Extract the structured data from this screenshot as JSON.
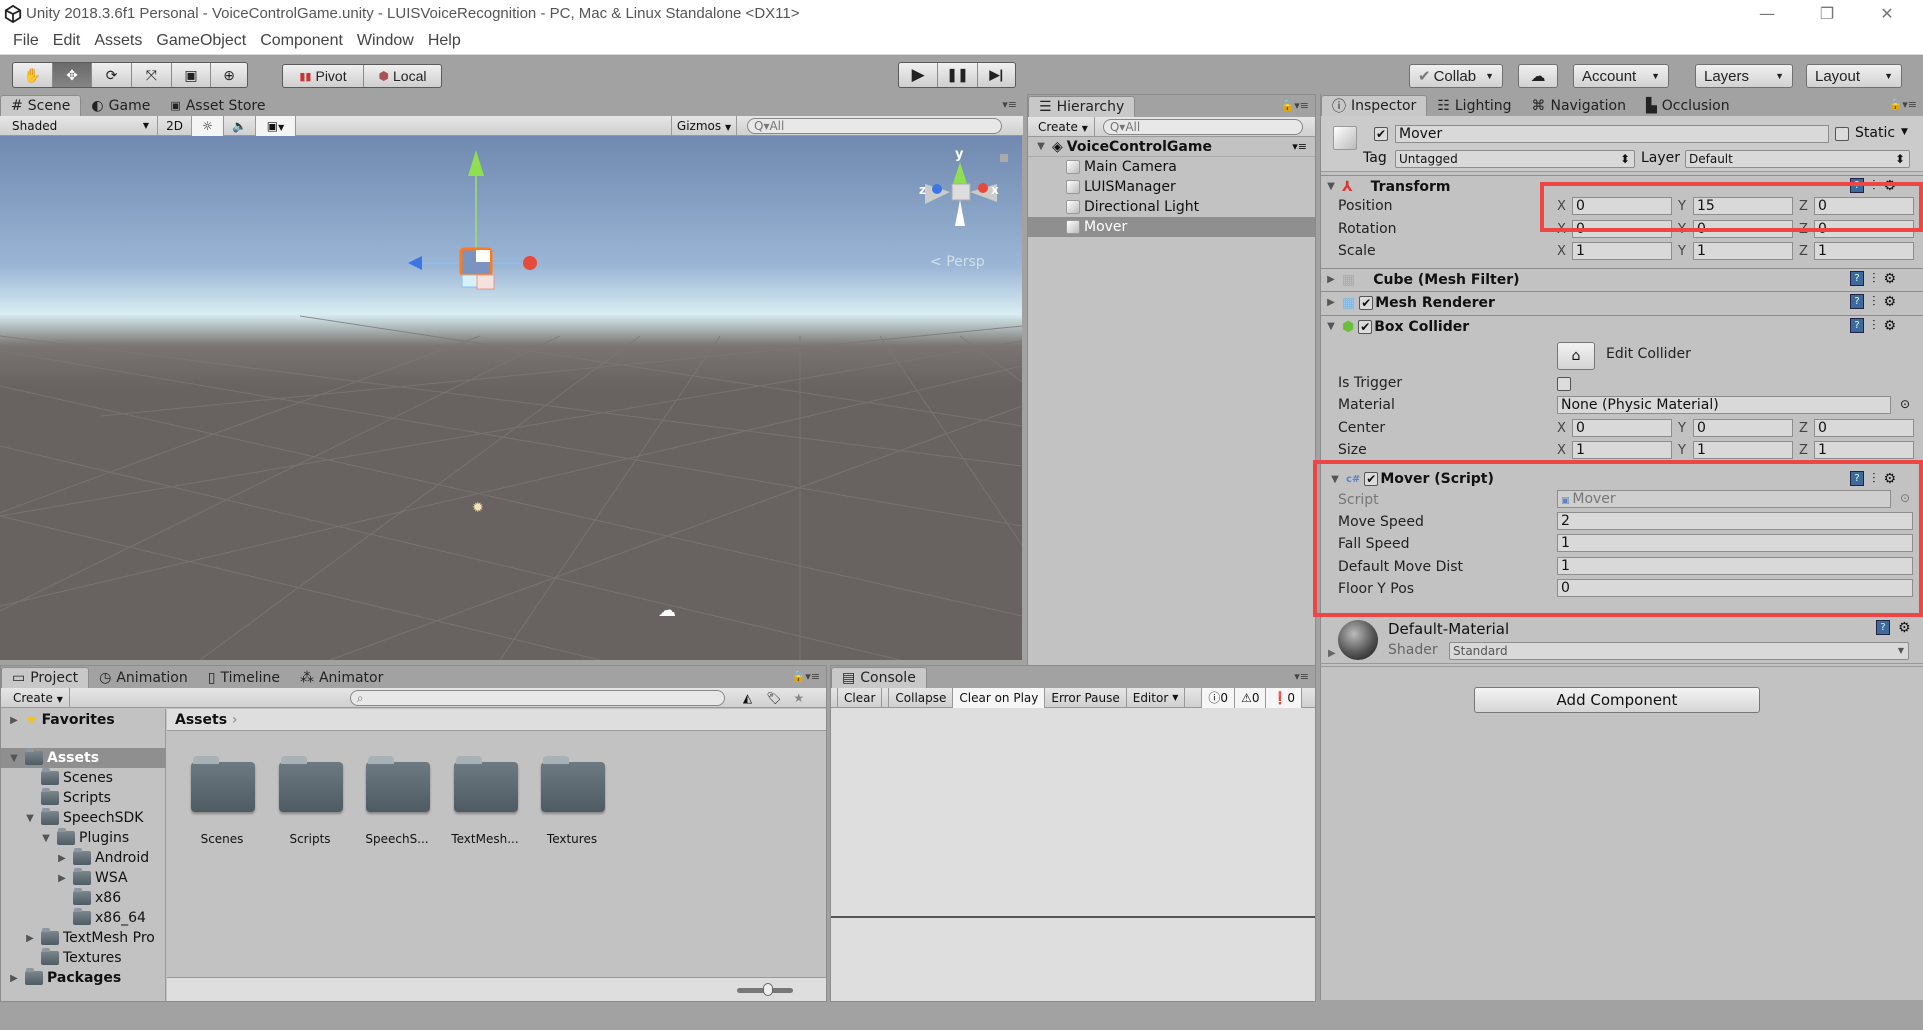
{
  "window": {
    "title": "Unity 2018.3.6f1 Personal - VoiceControlGame.unity - LUISVoiceRecognition - PC, Mac & Linux Standalone <DX11>",
    "controls": {
      "minimize": "—",
      "maximize": "❐",
      "close": "✕"
    }
  },
  "menu": [
    "File",
    "Edit",
    "Assets",
    "GameObject",
    "Component",
    "Window",
    "Help"
  ],
  "toolbar": {
    "tools": [
      {
        "name": "hand-tool",
        "glyph": "✋",
        "active": false
      },
      {
        "name": "move-tool",
        "glyph": "✥",
        "active": true
      },
      {
        "name": "rotate-tool",
        "glyph": "⟳",
        "active": false
      },
      {
        "name": "scale-tool",
        "glyph": "⤧",
        "active": false
      },
      {
        "name": "rect-tool",
        "glyph": "▣",
        "active": false
      },
      {
        "name": "transform-tool",
        "glyph": "⊕",
        "active": false
      }
    ],
    "pivot_label": "Pivot",
    "local_label": "Local",
    "play": "▶",
    "pause": "❚❚",
    "step": "▶|",
    "collab_label": "Collab",
    "cloud_glyph": "☁",
    "account_label": "Account",
    "layers_label": "Layers",
    "layout_label": "Layout"
  },
  "scene_panel": {
    "tabs": [
      {
        "label": "Scene",
        "icon": "#",
        "active": true
      },
      {
        "label": "Game",
        "icon": "◐",
        "active": false
      },
      {
        "label": "Asset Store",
        "icon": "🛍",
        "active": false
      }
    ],
    "shading_mode": "Shaded",
    "mode_2d": "2D",
    "gizmos_label": "Gizmos",
    "search_placeholder": "All",
    "persp_label": "Persp",
    "axis_labels": {
      "x": "x",
      "y": "y",
      "z": "z"
    }
  },
  "hierarchy": {
    "tab_label": "Hierarchy",
    "create_label": "Create",
    "search_placeholder": "All",
    "scene_name": "VoiceControlGame",
    "items": [
      {
        "label": "Main Camera",
        "selected": false
      },
      {
        "label": "LUISManager",
        "selected": false
      },
      {
        "label": "Directional Light",
        "selected": false
      },
      {
        "label": "Mover",
        "selected": true
      }
    ]
  },
  "inspector": {
    "tabs": [
      {
        "label": "Inspector",
        "active": true
      },
      {
        "label": "Lighting",
        "active": false
      },
      {
        "label": "Navigation",
        "active": false
      },
      {
        "label": "Occlusion",
        "active": false
      }
    ],
    "object_name": "Mover",
    "active": true,
    "static_label": "Static",
    "tag_label": "Tag",
    "tag_value": "Untagged",
    "layer_label": "Layer",
    "layer_value": "Default",
    "transform": {
      "title": "Transform",
      "position": {
        "label": "Position",
        "x": "0",
        "y": "15",
        "z": "0"
      },
      "rotation": {
        "label": "Rotation",
        "x": "0",
        "y": "0",
        "z": "0"
      },
      "scale": {
        "label": "Scale",
        "x": "1",
        "y": "1",
        "z": "1"
      }
    },
    "mesh_filter_title": "Cube (Mesh Filter)",
    "mesh_renderer_title": "Mesh Renderer",
    "box_collider": {
      "title": "Box Collider",
      "edit_collider_label": "Edit Collider",
      "is_trigger_label": "Is Trigger",
      "material_label": "Material",
      "material_value": "None (Physic Material)",
      "center": {
        "label": "Center",
        "x": "0",
        "y": "0",
        "z": "0"
      },
      "size": {
        "label": "Size",
        "x": "1",
        "y": "1",
        "z": "1"
      }
    },
    "mover_script": {
      "title": "Mover (Script)",
      "script_label": "Script",
      "script_value": "Mover",
      "fields": [
        {
          "label": "Move Speed",
          "value": "2"
        },
        {
          "label": "Fall Speed",
          "value": "1"
        },
        {
          "label": "Default Move Dist",
          "value": "1"
        },
        {
          "label": "Floor Y Pos",
          "value": "0"
        }
      ]
    },
    "material": {
      "name": "Default-Material",
      "shader_label": "Shader",
      "shader_value": "Standard"
    },
    "add_component_label": "Add Component",
    "axis": {
      "x": "X",
      "y": "Y",
      "z": "Z"
    },
    "highlight_color": "#f04545"
  },
  "project": {
    "tabs": [
      {
        "label": "Project",
        "active": true
      },
      {
        "label": "Animation",
        "active": false
      },
      {
        "label": "Timeline",
        "active": false
      },
      {
        "label": "Animator",
        "active": false
      }
    ],
    "create_label": "Create",
    "favorites_label": "Favorites",
    "tree": [
      {
        "label": "Assets",
        "depth": 0,
        "arrow": "▼",
        "bold": true,
        "selected": true
      },
      {
        "label": "Scenes",
        "depth": 1,
        "arrow": "",
        "bold": false
      },
      {
        "label": "Scripts",
        "depth": 1,
        "arrow": "",
        "bold": false
      },
      {
        "label": "SpeechSDK",
        "depth": 1,
        "arrow": "▼",
        "bold": false
      },
      {
        "label": "Plugins",
        "depth": 2,
        "arrow": "▼",
        "bold": false
      },
      {
        "label": "Android",
        "depth": 3,
        "arrow": "▶",
        "bold": false
      },
      {
        "label": "WSA",
        "depth": 3,
        "arrow": "▶",
        "bold": false
      },
      {
        "label": "x86",
        "depth": 3,
        "arrow": "",
        "bold": false
      },
      {
        "label": "x86_64",
        "depth": 3,
        "arrow": "",
        "bold": false
      },
      {
        "label": "TextMesh Pro",
        "depth": 1,
        "arrow": "▶",
        "bold": false
      },
      {
        "label": "Textures",
        "depth": 1,
        "arrow": "",
        "bold": false
      },
      {
        "label": "Packages",
        "depth": 0,
        "arrow": "▶",
        "bold": true
      }
    ],
    "breadcrumb": "Assets",
    "folders": [
      "Scenes",
      "Scripts",
      "SpeechS...",
      "TextMesh...",
      "Textures"
    ]
  },
  "console": {
    "tab_label": "Console",
    "buttons": [
      "Clear",
      "Collapse",
      "Clear on Play",
      "Error Pause",
      "Editor"
    ],
    "info_count": "0",
    "warning_count": "0",
    "error_count": "0"
  }
}
